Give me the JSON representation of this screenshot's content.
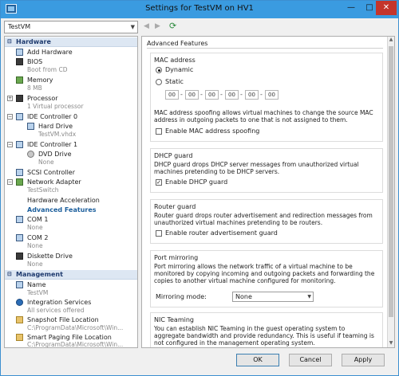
{
  "window": {
    "title": "Settings for TestVM on HV1",
    "controls": {
      "minimize": "—",
      "maximize": "□",
      "close": "✕"
    }
  },
  "toolbar": {
    "vm_selected": "TestVM",
    "back_icon": "◀",
    "forward_icon": "▶",
    "refresh_icon": "⟳"
  },
  "sidebar": {
    "hardware_header": "Hardware",
    "management_header": "Management",
    "items": {
      "add_hardware": "Add Hardware",
      "bios": "BIOS",
      "bios_sub": "Boot from CD",
      "memory": "Memory",
      "memory_sub": "8 MB",
      "processor": "Processor",
      "processor_sub": "1 Virtual processor",
      "ide0": "IDE Controller 0",
      "hard_drive": "Hard Drive",
      "hard_drive_sub": "TestVM.vhdx",
      "ide1": "IDE Controller 1",
      "dvd_drive": "DVD Drive",
      "dvd_drive_sub": "None",
      "scsi": "SCSI Controller",
      "network_adapter": "Network Adapter",
      "network_adapter_sub": "TestSwitch",
      "hw_accel": "Hardware Acceleration",
      "adv_features": "Advanced Features",
      "com1": "COM 1",
      "com1_sub": "None",
      "com2": "COM 2",
      "com2_sub": "None",
      "diskette": "Diskette Drive",
      "diskette_sub": "None",
      "name": "Name",
      "name_sub": "TestVM",
      "integration": "Integration Services",
      "integration_sub": "All services offered",
      "snapshot": "Snapshot File Location",
      "snapshot_sub": "C:\\ProgramData\\Microsoft\\Win...",
      "paging": "Smart Paging File Location",
      "paging_sub": "C:\\ProgramData\\Microsoft\\Win..."
    }
  },
  "panel": {
    "title": "Advanced Features",
    "mac": {
      "title": "MAC address",
      "dynamic": "Dynamic",
      "static": "Static",
      "octets": [
        "00",
        "00",
        "00",
        "00",
        "00",
        "00"
      ],
      "separator": "-",
      "desc": "MAC address spoofing allows virtual machines to change the source MAC address in outgoing packets to one that is not assigned to them.",
      "spoof_label": "Enable MAC address spoofing",
      "selected": "Dynamic"
    },
    "dhcp": {
      "title": "DHCP guard",
      "desc": "DHCP guard drops DHCP server messages from unauthorized virtual machines pretending to be DHCP servers.",
      "enable_label": "Enable DHCP guard",
      "checked": true
    },
    "router": {
      "title": "Router guard",
      "desc": "Router guard drops router advertisement and redirection messages from unauthorized virtual machines pretending to be routers.",
      "enable_label": "Enable router advertisement guard",
      "checked": false
    },
    "mirroring": {
      "title": "Port mirroring",
      "desc": "Port mirroring allows the network traffic of a virtual machine to be monitored by copying incoming and outgoing packets and forwarding the copies to another virtual machine configured for monitoring.",
      "mode_label": "Mirroring mode:",
      "mode_value": "None"
    },
    "nic": {
      "title": "NIC Teaming",
      "desc": "You can establish NIC Teaming in the guest operating system to aggregate bandwidth and provide redundancy. This is useful if teaming is not configured in the management operating system."
    }
  },
  "footer": {
    "ok": "OK",
    "cancel": "Cancel",
    "apply": "Apply"
  },
  "colors": {
    "titlebar": "#3a9be0",
    "close": "#c4352c",
    "selected_text": "#1b5e9c",
    "section_head": "#dde7f3"
  }
}
